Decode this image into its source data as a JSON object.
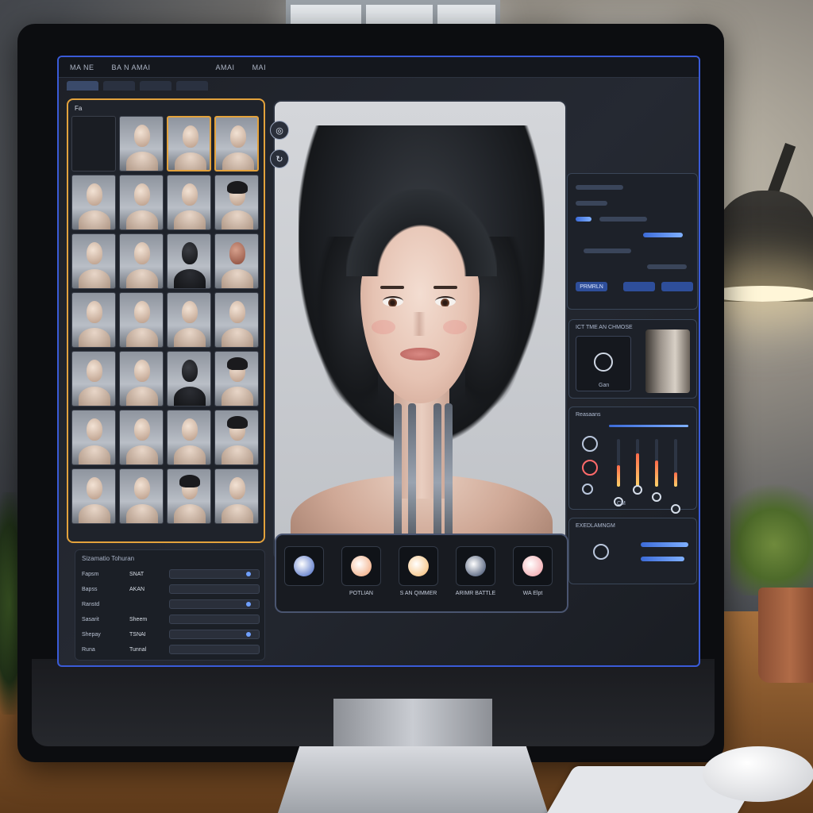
{
  "app": {
    "menu": [
      "MA NE",
      "BA N AMAI",
      "AMAI",
      "MAI"
    ],
    "tabs": [
      "",
      "",
      "",
      ""
    ]
  },
  "library": {
    "title": "Fa       ",
    "tiles": [
      {
        "kind": "empty"
      },
      {
        "kind": "bald"
      },
      {
        "kind": "bald"
      },
      {
        "kind": "bald"
      },
      {
        "kind": "bald"
      },
      {
        "kind": "bald"
      },
      {
        "kind": "bald"
      },
      {
        "kind": "hair"
      },
      {
        "kind": "bald"
      },
      {
        "kind": "bald"
      },
      {
        "kind": "dark"
      },
      {
        "kind": "tattoo"
      },
      {
        "kind": "bald"
      },
      {
        "kind": "bald"
      },
      {
        "kind": "bald"
      },
      {
        "kind": "bald"
      },
      {
        "kind": "bald"
      },
      {
        "kind": "bald"
      },
      {
        "kind": "dark"
      },
      {
        "kind": "hair"
      },
      {
        "kind": "bald"
      },
      {
        "kind": "bald"
      },
      {
        "kind": "bald"
      },
      {
        "kind": "hair"
      },
      {
        "kind": "bald"
      },
      {
        "kind": "bald"
      },
      {
        "kind": "hair"
      },
      {
        "kind": "bald"
      }
    ]
  },
  "properties": {
    "title": "Sizamatio Tohuran",
    "rows": [
      {
        "label": "Fapsm",
        "value": "SNAT"
      },
      {
        "label": "Bapss",
        "value": "AKAN"
      },
      {
        "label": "Ranstd",
        "value": ""
      },
      {
        "label": "Sasarit",
        "value": "Sheem"
      },
      {
        "label": "Shepay",
        "value": "TSNAI"
      },
      {
        "label": "Runa",
        "value": "Tunnal"
      }
    ]
  },
  "right": {
    "top_button": "PRMRLN",
    "mid_title": "ICT TME AN CHMOSE",
    "mid_caption": "Gan",
    "sliders_title": "Reasaans",
    "slider_levels": [
      0.45,
      0.7,
      0.55,
      0.3
    ],
    "slider_value": "CM",
    "bottom_title": "EXEDLAMNGM"
  },
  "toolbar": {
    "swatches": [
      {
        "label": "",
        "color": "#3b5fbf"
      },
      {
        "label": "POTLIAN",
        "color": "#f0a070"
      },
      {
        "label": "S AN QIMMER",
        "color": "#f5b86a"
      },
      {
        "label": "ARIMR BATTLE",
        "color": "#2c3d5e"
      },
      {
        "label": "WA Elpt",
        "color": "#f09aa0"
      }
    ]
  },
  "colors": {
    "accent": "#e3a23c",
    "frame": "#3a5bd8"
  }
}
